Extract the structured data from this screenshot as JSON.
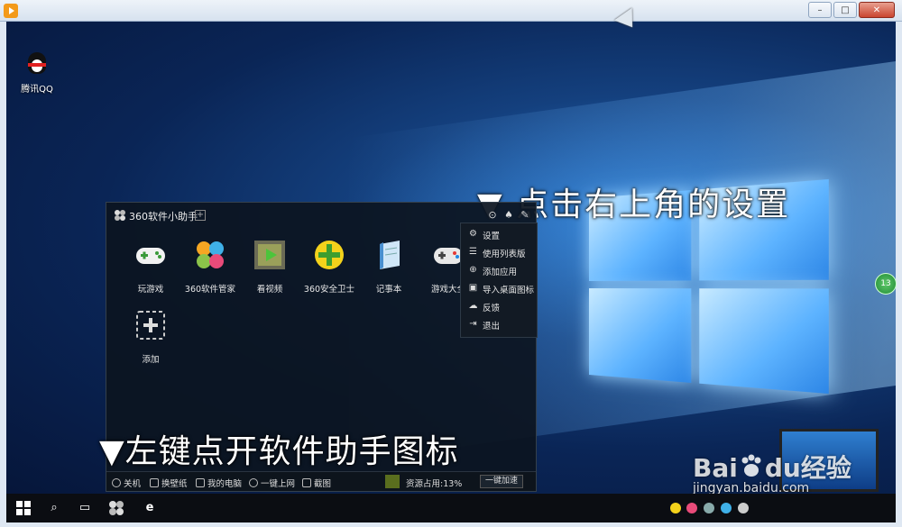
{
  "window": {
    "controls": {
      "minimize": "–",
      "maximize": "□",
      "close": "✕"
    }
  },
  "desktop": {
    "icons": [
      {
        "label": "腾讯QQ",
        "icon": "qq-penguin-icon"
      }
    ],
    "annotations": {
      "top": "▼ 点击右上角的设置",
      "bottom": "▼左键点开软件助手图标"
    },
    "side_badge": "13"
  },
  "panel": {
    "title": "360软件小助手",
    "apps": [
      {
        "label": "玩游戏",
        "icon": "gamepad-icon"
      },
      {
        "label": "360软件管家",
        "icon": "software-manager-icon"
      },
      {
        "label": "看视频",
        "icon": "video-icon"
      },
      {
        "label": "360安全卫士",
        "icon": "security-guard-icon"
      },
      {
        "label": "记事本",
        "icon": "notepad-icon"
      },
      {
        "label": "游戏大全",
        "icon": "game-center-icon"
      },
      {
        "label": "添加",
        "icon": "add-icon"
      }
    ],
    "menu": [
      {
        "label": "设置",
        "icon": "gear-icon"
      },
      {
        "label": "使用列表版",
        "icon": "list-icon"
      },
      {
        "label": "添加应用",
        "icon": "add-app-icon"
      },
      {
        "label": "导入桌面图标",
        "icon": "import-icon"
      },
      {
        "label": "反馈",
        "icon": "feedback-icon"
      },
      {
        "label": "退出",
        "icon": "exit-icon"
      }
    ],
    "bottom_bar": {
      "shutdown": "关机",
      "wallpaper": "换壁纸",
      "my_computer": "我的电脑",
      "one_click_online": "一键上网",
      "screenshot": "截图",
      "resource_usage": "资源占用:13%",
      "accelerate": "一键加速"
    }
  },
  "watermark": {
    "brand": "Bai",
    "brand_suffix": "du",
    "brand_cn": "经验",
    "site": "jingyan.baidu.com"
  },
  "colors": {
    "panel_bg": "#0c1420",
    "desktop_accent": "#2d7fd6",
    "badge_green": "#1f8a34"
  }
}
